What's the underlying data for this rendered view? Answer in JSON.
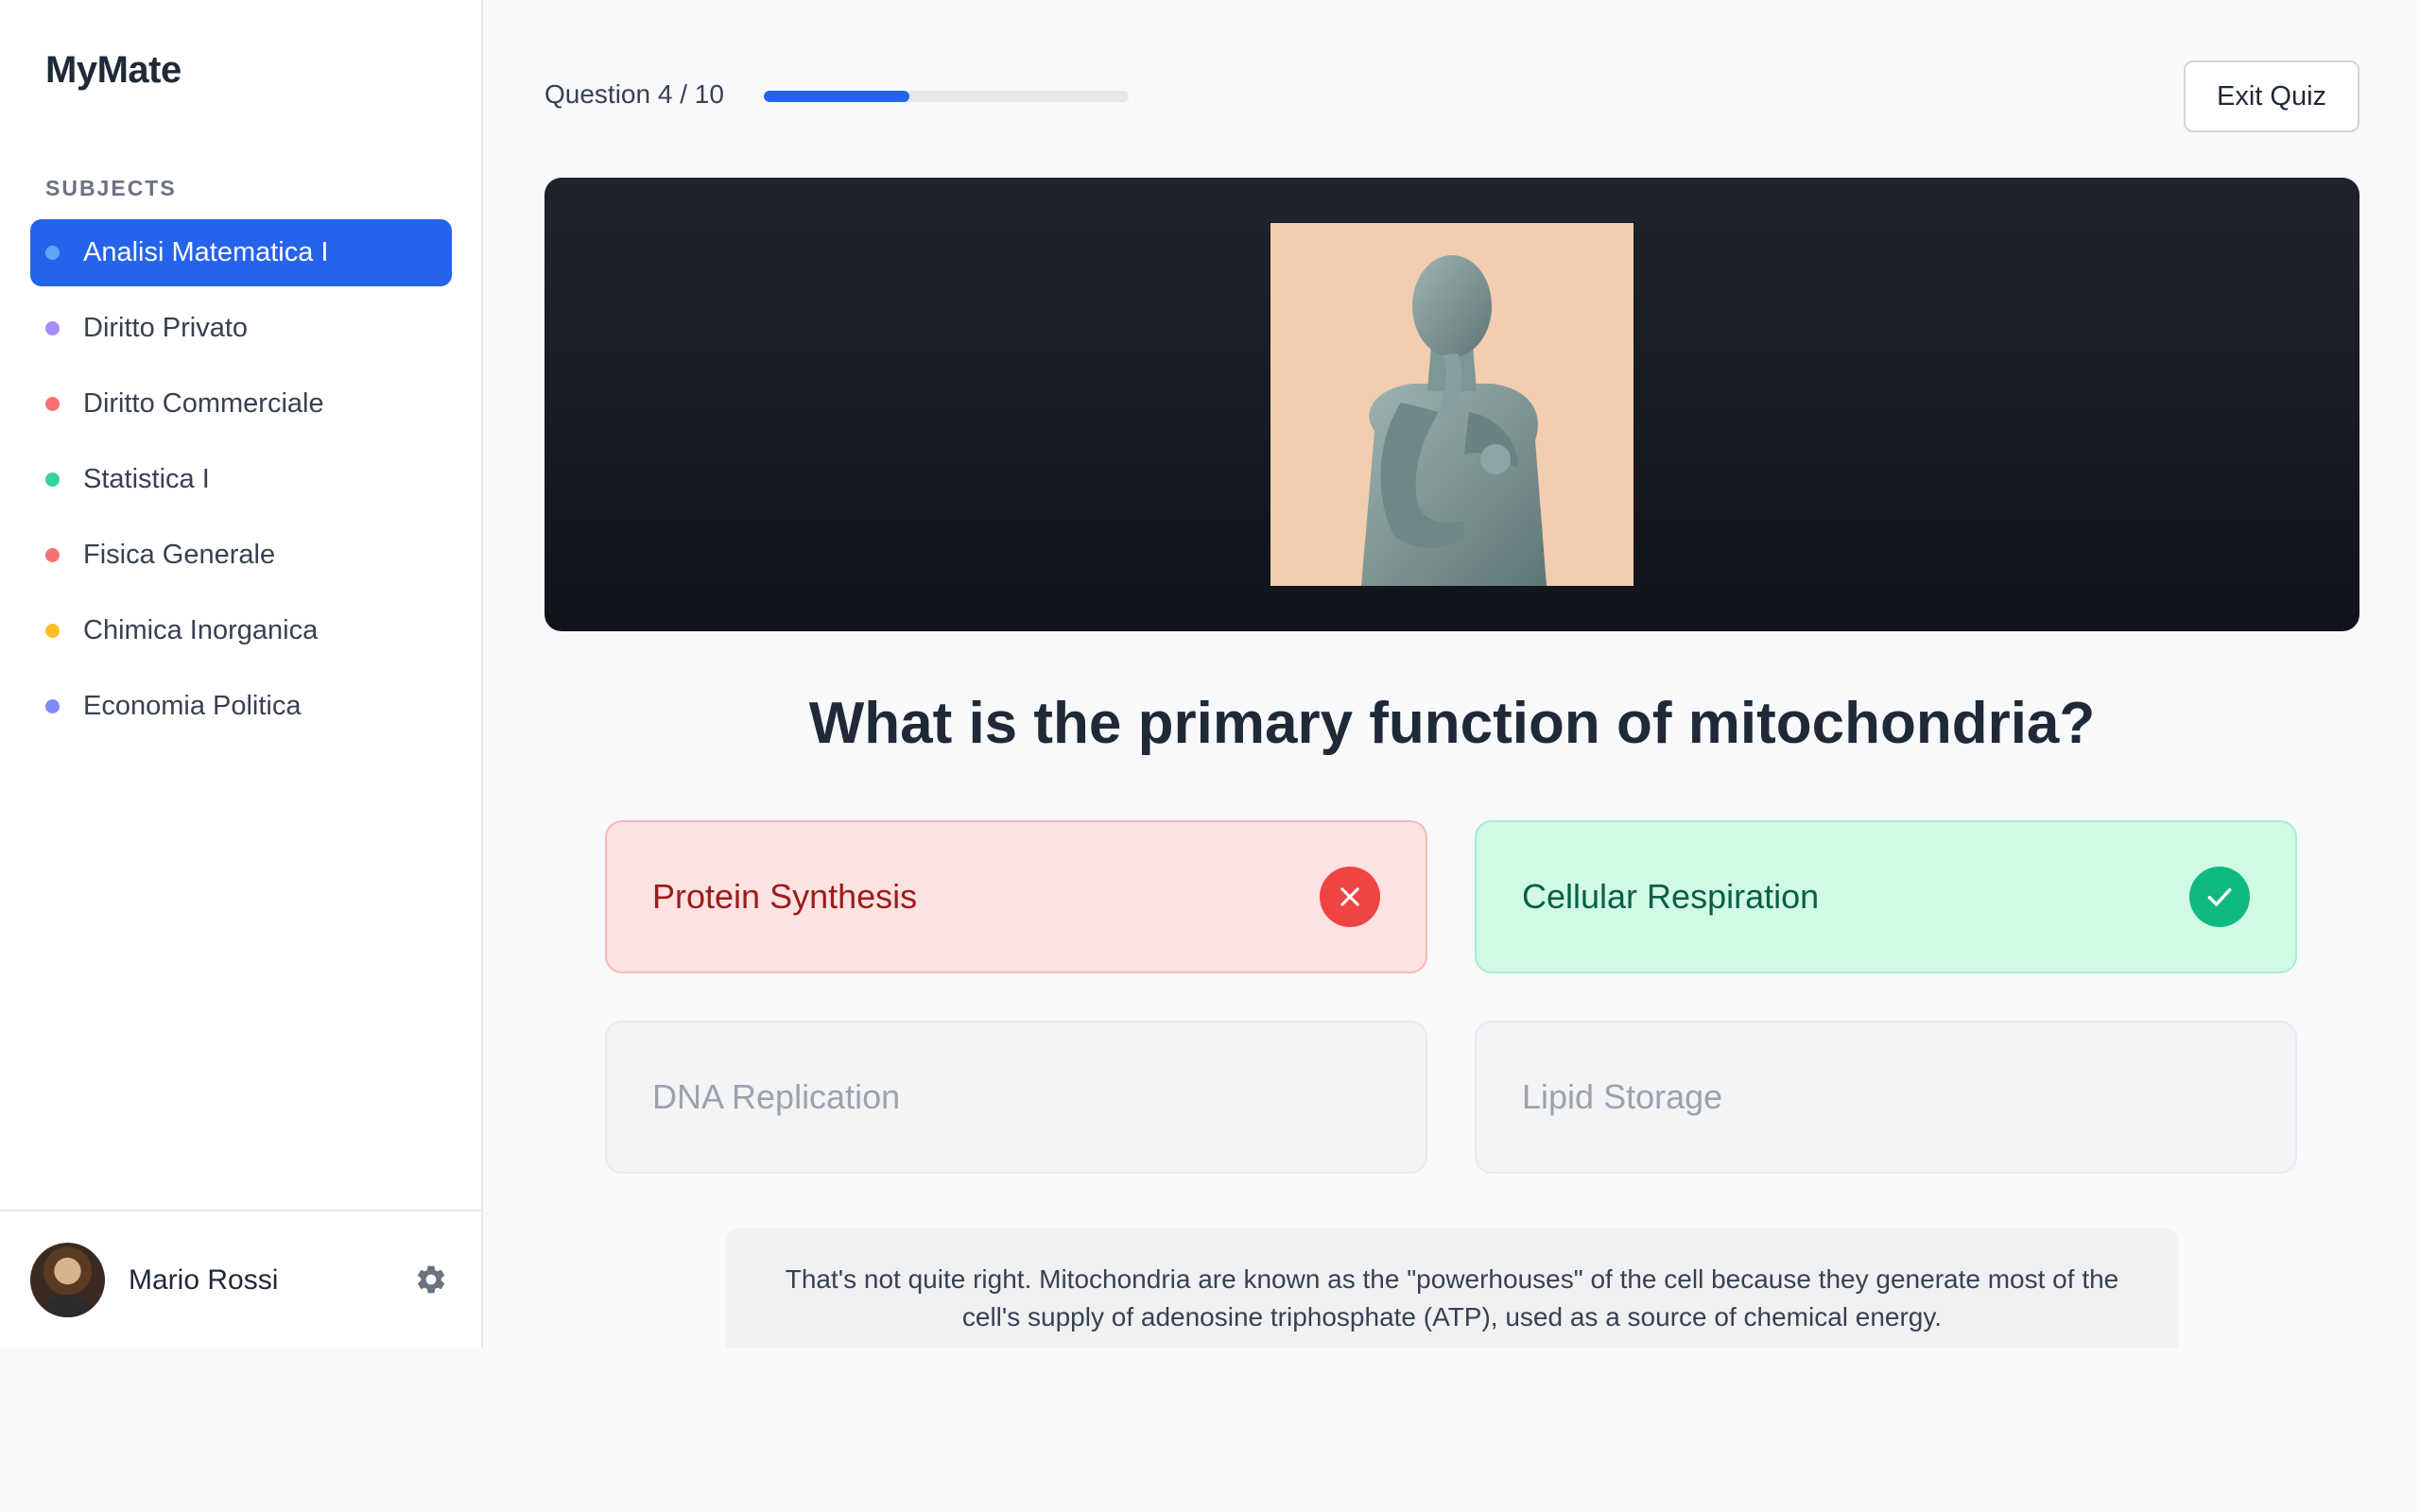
{
  "app": {
    "name": "MyMate"
  },
  "sidebar": {
    "section_label": "SUBJECTS",
    "items": [
      {
        "label": "Analisi Matematica I",
        "color": "#60a5fa",
        "active": true
      },
      {
        "label": "Diritto Privato",
        "color": "#a78bfa",
        "active": false
      },
      {
        "label": "Diritto Commerciale",
        "color": "#f87171",
        "active": false
      },
      {
        "label": "Statistica I",
        "color": "#34d399",
        "active": false
      },
      {
        "label": "Fisica Generale",
        "color": "#f87171",
        "active": false
      },
      {
        "label": "Chimica Inorganica",
        "color": "#fbbf24",
        "active": false
      },
      {
        "label": "Economia Politica",
        "color": "#818cf8",
        "active": false
      }
    ],
    "user": {
      "name": "Mario Rossi",
      "avatar_icon": "user-avatar",
      "settings_icon": "gear-icon"
    }
  },
  "quiz": {
    "progress_label": "Question 4 / 10",
    "progress_fraction": 0.4,
    "exit_label": "Exit Quiz",
    "image_icon": "human-figure-statue",
    "question": "What is the primary function of mitochondria?",
    "answers": [
      {
        "label": "Protein Synthesis",
        "state": "wrong",
        "icon": "close-icon"
      },
      {
        "label": "Cellular Respiration",
        "state": "correct",
        "icon": "check-icon"
      },
      {
        "label": "DNA Replication",
        "state": "neutral"
      },
      {
        "label": "Lipid Storage",
        "state": "neutral"
      }
    ],
    "feedback": "That's not quite right. Mitochondria are known as the \"powerhouses\" of the cell because they generate most of the cell's supply of adenosine triphosphate (ATP), used as a source of chemical energy."
  },
  "colors": {
    "accent": "#2563eb",
    "wrong": "#ef4444",
    "correct": "#10b981"
  }
}
